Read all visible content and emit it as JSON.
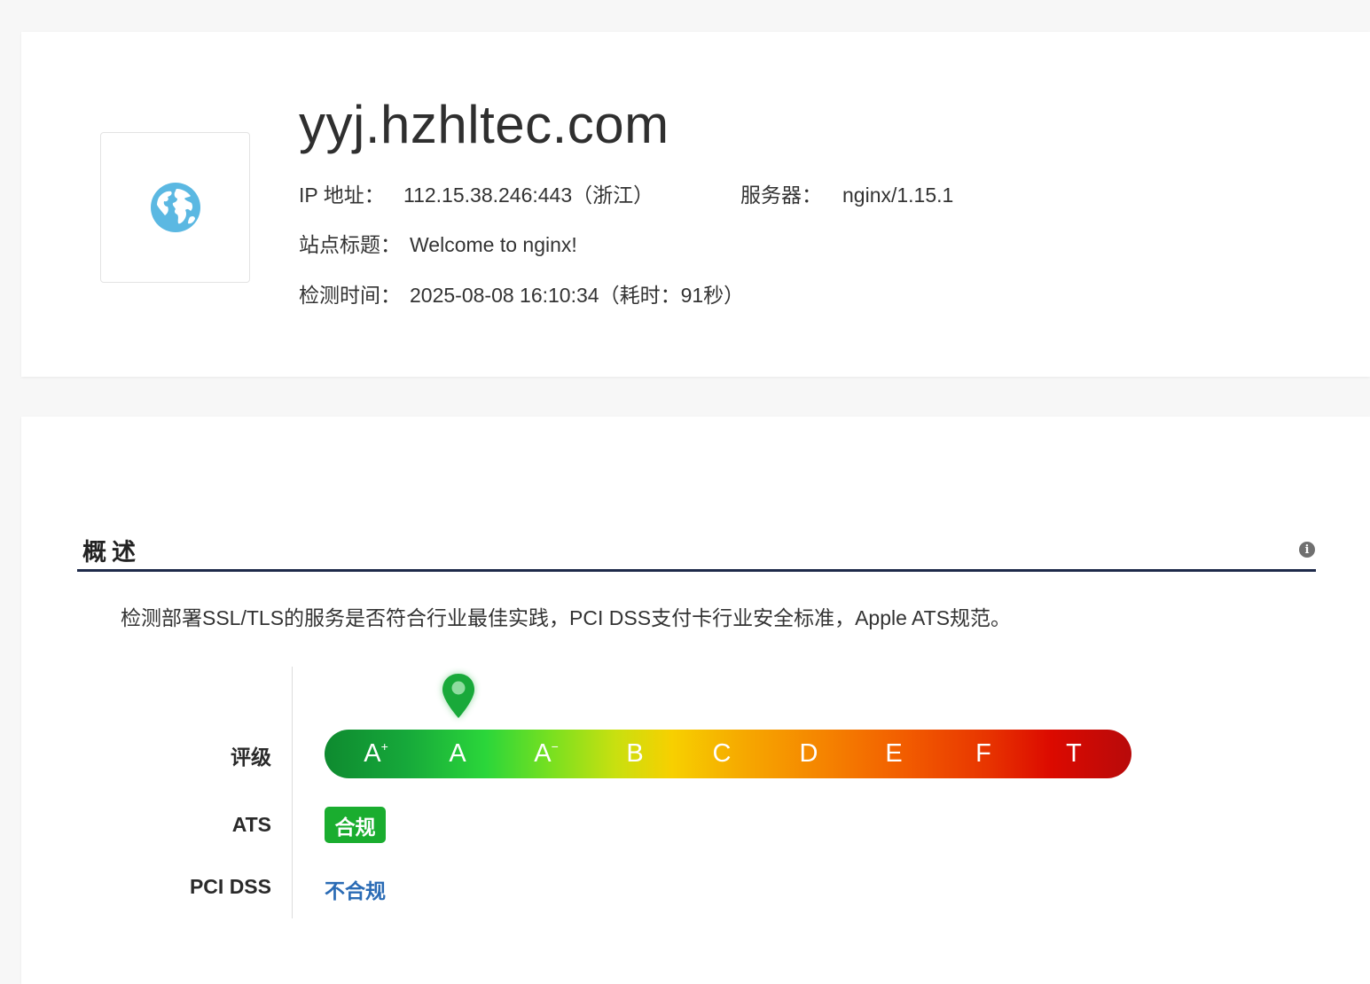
{
  "site": {
    "domain": "yyj.hzhltec.com",
    "logo_icon": "globe-icon",
    "ip_label": "IP 地址：",
    "ip_value": "112.15.38.246:443（浙江）",
    "server_label": "服务器：",
    "server_value": "nginx/1.15.1",
    "title_label": "站点标题：",
    "title_value": "Welcome to nginx!",
    "time_label": "检测时间：",
    "time_value": "2025-08-08 16:10:34（耗时：91秒）"
  },
  "summary": {
    "heading": "概述",
    "info_icon": "info-icon",
    "description": "检测部署SSL/TLS的服务是否符合行业最佳实践，PCI DSS支付卡行业安全标准，Apple ATS规范。",
    "grade_label": "评级",
    "grades": [
      {
        "letter": "A",
        "mod": "+"
      },
      {
        "letter": "A",
        "mod": ""
      },
      {
        "letter": "A",
        "mod": "−"
      },
      {
        "letter": "B",
        "mod": ""
      },
      {
        "letter": "C",
        "mod": ""
      },
      {
        "letter": "D",
        "mod": ""
      },
      {
        "letter": "E",
        "mod": ""
      },
      {
        "letter": "F",
        "mod": ""
      },
      {
        "letter": "T",
        "mod": ""
      }
    ],
    "current_grade": "A",
    "marker_icon": "map-pin-icon",
    "ats_label": "ATS",
    "ats_status": "合规",
    "pci_label": "PCI DSS",
    "pci_status": "不合规",
    "colors": {
      "ats_badge": "#1aad2f",
      "pci_status": "#2a6bb5",
      "heading_rule": "#1e2a4a",
      "marker": "#19a93a"
    }
  }
}
